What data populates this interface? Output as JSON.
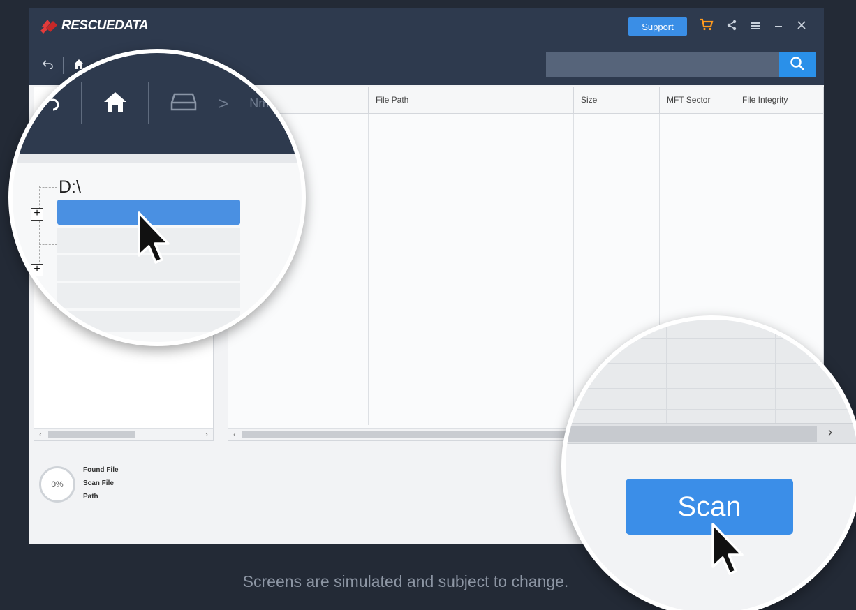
{
  "app": {
    "brand": "RESCUEDATA",
    "support_label": "Support",
    "search_placeholder": ""
  },
  "table": {
    "columns": [
      "Name",
      "File Path",
      "Size",
      "MFT Sector",
      "File Integrity"
    ],
    "name_partial": "me"
  },
  "tree": {
    "root_label": "D:\\"
  },
  "status": {
    "progress": "0%",
    "lines": [
      "Found File",
      "Scan File",
      "Path"
    ]
  },
  "scan_label": "Scan",
  "footer_note": "Screens are simulated and subject to change.",
  "icons": {
    "titlebar": [
      "cart-icon",
      "share-icon",
      "menu-icon",
      "minimize-icon",
      "close-icon"
    ],
    "toolbar": [
      "back-icon",
      "home-icon"
    ]
  },
  "colors": {
    "header": "#2e3a4e",
    "accent": "#3a8ee6",
    "selection": "#4a90e2",
    "cart": "#ff9a1e"
  }
}
